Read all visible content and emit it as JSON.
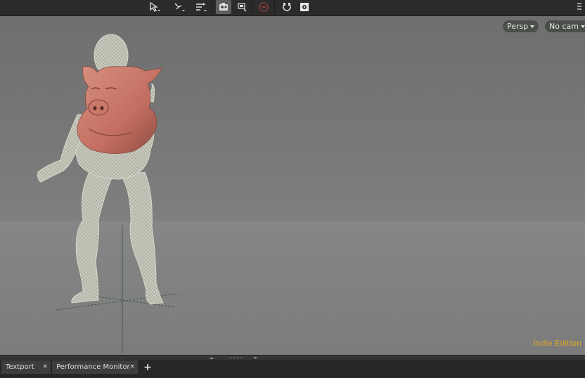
{
  "toolbar": {
    "tools": [
      {
        "name": "select-tool-icon"
      },
      {
        "name": "pose-tool-icon"
      },
      {
        "name": "handle-tool-icon"
      },
      {
        "name": "view-tool-icon"
      },
      {
        "name": "camera-tool-icon"
      },
      {
        "name": "record-icon"
      },
      {
        "name": "snap-icon"
      },
      {
        "name": "gear-icon"
      }
    ]
  },
  "viewport": {
    "projection_label": "Persp",
    "camera_label": "No cam",
    "edition_label": "Indie Edition",
    "edition_color": "#e0a81b",
    "subject": "pig-head-character"
  },
  "tabs": [
    {
      "label": "Textport",
      "close": "×"
    },
    {
      "label": "Performance Monitor",
      "close": "×"
    }
  ],
  "add_tab_label": "+",
  "colors": {
    "accent": "#e0a81b",
    "viewport_bg": "#7a7a7a",
    "pig_skin": "#c97a6a"
  }
}
